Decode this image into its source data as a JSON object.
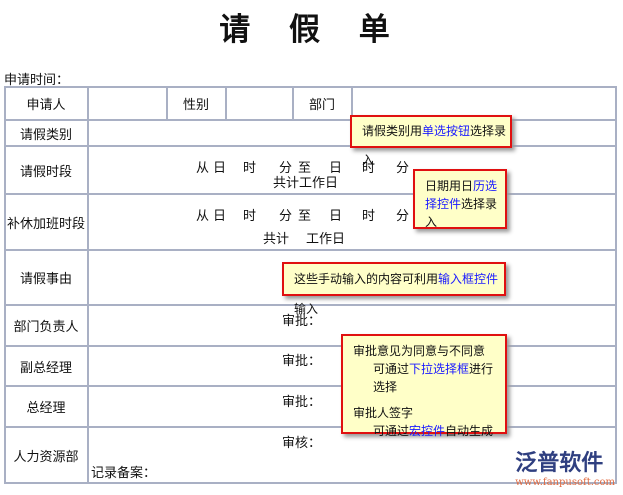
{
  "title": "请 假 单",
  "apply_time_label": "申请时间：",
  "labels": {
    "applicant": "申请人",
    "gender": "性别",
    "department": "部门",
    "leave_type": "请假类别",
    "leave_period": "请假时段",
    "comp_period": "补休加班时段",
    "reason": "请假事由",
    "dept_head": "部门负责人",
    "vice_gm": "副总经理",
    "gm": "总经理",
    "hr": "人力资源部"
  },
  "period": {
    "from": "从",
    "day": "日",
    "hour": "时",
    "minute": "分",
    "to": "至",
    "total": "共计",
    "workdays": "工作日"
  },
  "approve_label": "审批：",
  "review_label": "审核：",
  "record_label": "记录备案：",
  "notes": {
    "n1": {
      "pre": "请假类别用",
      "link": "单选按钮",
      "post": "选择录入"
    },
    "n2": {
      "pre": "日期用日",
      "link": "历选择控件",
      "post": "选择录入"
    },
    "n3": {
      "pre": "这些手动输入的内容可利用",
      "link": "输入框控件",
      "post": "输入"
    },
    "n4": {
      "l1": "审批意见为同意与不同意",
      "l2pre": "可通过",
      "l2link": "下拉选择框",
      "l2post": "进行选择",
      "l3": "审批人签字",
      "l4pre": "可通过",
      "l4link": "宏控件",
      "l4post": "自动生成"
    }
  },
  "logo": {
    "name": "泛普软件",
    "url": "www.fanpusoft.com"
  }
}
